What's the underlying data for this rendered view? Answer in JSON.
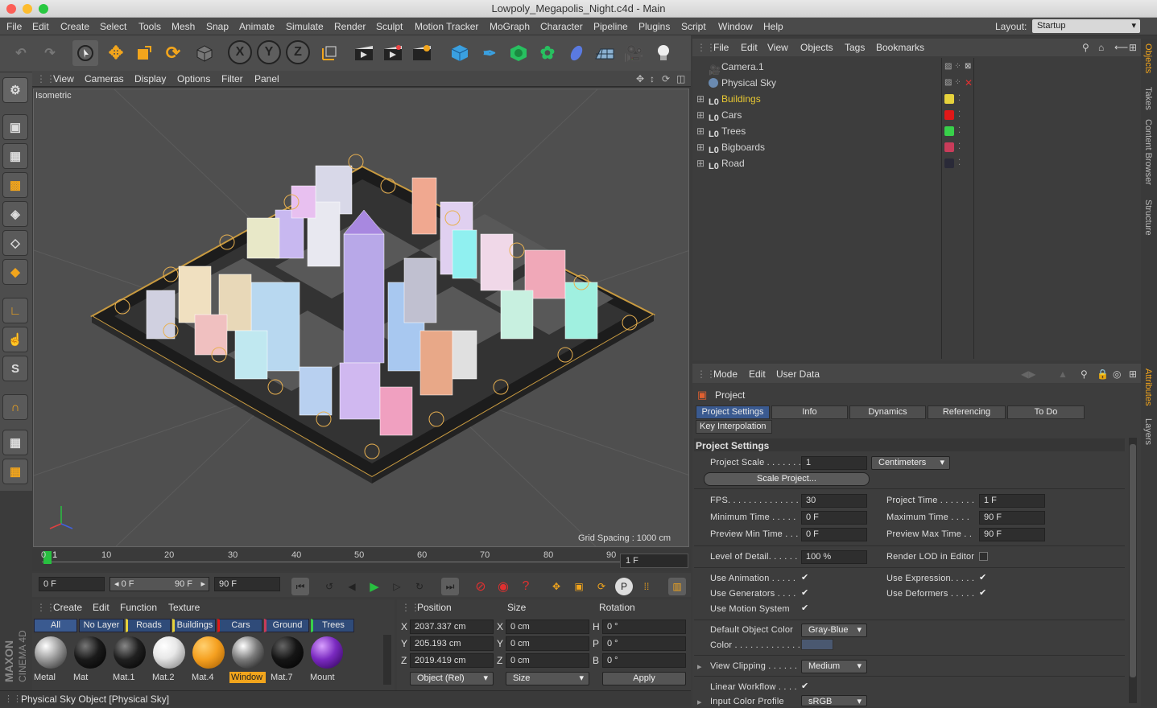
{
  "window": {
    "title": "Lowpoly_Megapolis_Night.c4d - Main"
  },
  "menu": [
    "File",
    "Edit",
    "Create",
    "Select",
    "Tools",
    "Mesh",
    "Snap",
    "Animate",
    "Simulate",
    "Render",
    "Sculpt",
    "Motion Tracker",
    "MoGraph",
    "Character",
    "Pipeline",
    "Plugins",
    "Script",
    "Window",
    "Help"
  ],
  "layout": {
    "label": "Layout:",
    "value": "Startup"
  },
  "axis_buttons": [
    "X",
    "Y",
    "Z"
  ],
  "viewport": {
    "menu": [
      "View",
      "Cameras",
      "Display",
      "Options",
      "Filter",
      "Panel"
    ],
    "projection": "Isometric",
    "grid_spacing": "Grid Spacing : 1000 cm"
  },
  "timeline": {
    "ticks": [
      "0",
      "10",
      "20",
      "30",
      "40",
      "50",
      "60",
      "70",
      "80",
      "90"
    ],
    "current_frame_mark": "1",
    "frame_display": "1 F"
  },
  "transport": {
    "start_field": "0 F",
    "range_min": "0 F",
    "range_max": "90 F",
    "end_field": "90 F"
  },
  "materials": {
    "menu": [
      "Create",
      "Edit",
      "Function",
      "Texture"
    ],
    "tabs": [
      "All",
      "No Layer",
      "Roads",
      "Buildings",
      "Cars",
      "Ground",
      "Trees"
    ],
    "items": [
      {
        "name": "Metal",
        "color": "#9a9a9a"
      },
      {
        "name": "Mat",
        "color": "#1a1a1a"
      },
      {
        "name": "Mat.1",
        "color": "#202020"
      },
      {
        "name": "Mat.2",
        "color": "#e8e8e8"
      },
      {
        "name": "Mat.4",
        "color": "#f5a020"
      },
      {
        "name": "Window",
        "color": "#7a7a7a",
        "selected": true
      },
      {
        "name": "Mat.7",
        "color": "#151515"
      },
      {
        "name": "Mount",
        "color": "#7a2ac0"
      }
    ]
  },
  "coordinates": {
    "headers": [
      "Position",
      "Size",
      "Rotation"
    ],
    "rows": [
      {
        "axis": "X",
        "pos": "2037.337 cm",
        "size_axis": "X",
        "size": "0 cm",
        "rot_axis": "H",
        "rot": "0 °"
      },
      {
        "axis": "Y",
        "pos": "205.193 cm",
        "size_axis": "Y",
        "size": "0 cm",
        "rot_axis": "P",
        "rot": "0 °"
      },
      {
        "axis": "Z",
        "pos": "2019.419 cm",
        "size_axis": "Z",
        "size": "0 cm",
        "rot_axis": "B",
        "rot": "0 °"
      }
    ],
    "mode": "Object (Rel)",
    "size_mode": "Size",
    "apply": "Apply"
  },
  "status": "Physical Sky Object [Physical Sky]",
  "objects": {
    "menu": [
      "File",
      "Edit",
      "View",
      "Objects",
      "Tags",
      "Bookmarks"
    ],
    "items": [
      {
        "name": "Camera.1",
        "color": "#d8d8d8",
        "layer": ""
      },
      {
        "name": "Physical Sky",
        "color": "#d8d8d8",
        "layer": ""
      },
      {
        "name": "Buildings",
        "color": "#e8c832",
        "layer": "#e6d23c"
      },
      {
        "name": "Cars",
        "color": "#d8d8d8",
        "layer": "#e01818"
      },
      {
        "name": "Trees",
        "color": "#d8d8d8",
        "layer": "#38d04a"
      },
      {
        "name": "Bigboards",
        "color": "#d8d8d8",
        "layer": "#c83c5a"
      },
      {
        "name": "Road",
        "color": "#d8d8d8",
        "layer": "#2a2a38"
      }
    ]
  },
  "attributes": {
    "menu": [
      "Mode",
      "Edit",
      "User Data"
    ],
    "object": "Project",
    "tabs": [
      "Project Settings",
      "Info",
      "Dynamics",
      "Referencing",
      "To Do",
      "Key Interpolation"
    ],
    "section": "Project Settings",
    "project_scale_label": "Project Scale . . . . . . .",
    "project_scale": "1",
    "scale_unit": "Centimeters",
    "scale_button": "Scale Project...",
    "fps_label": "FPS. . . . . . . . . . . . . . . .",
    "fps": "30",
    "project_time_label": "Project Time . . . . . . .",
    "project_time": "1 F",
    "min_time_label": "Minimum Time . . . . .",
    "min_time": "0 F",
    "max_time_label": "Maximum Time . . . .",
    "max_time": "90 F",
    "prev_min_label": "Preview Min Time . . .",
    "prev_min": "0 F",
    "prev_max_label": "Preview Max Time . .",
    "prev_max": "90 F",
    "lod_label": "Level of Detail. . . . . .",
    "lod": "100 %",
    "render_lod_label": "Render LOD in Editor",
    "use_animation": "Use Animation . . . . .",
    "use_expression": "Use Expression. . . . .",
    "use_generators": "Use Generators . . . .",
    "use_deformers": "Use Deformers . . . . .",
    "use_motion": "Use Motion System",
    "default_color_label": "Default Object Color",
    "default_color": "Gray-Blue",
    "color_label": "Color . . . . . . . . . . . . .",
    "view_clipping_label": "View Clipping . . . . . .",
    "view_clipping": "Medium",
    "linear_label": "Linear Workflow . . . .",
    "input_profile_label": "Input Color Profile",
    "input_profile": "sRGB"
  },
  "side_tabs": [
    "Objects",
    "Takes",
    "Content Browser",
    "Structure",
    "Attributes",
    "Layers"
  ],
  "left_logo": "MAXON CINEMA 4D"
}
